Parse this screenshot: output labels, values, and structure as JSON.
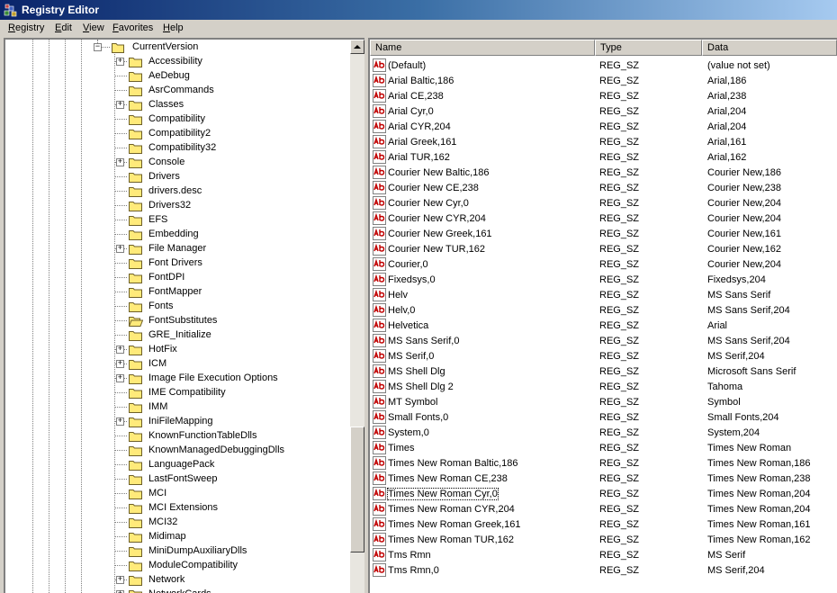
{
  "window": {
    "title": "Registry Editor"
  },
  "menu": [
    "Registry",
    "Edit",
    "View",
    "Favorites",
    "Help"
  ],
  "tree": {
    "parent": {
      "label": "CurrentVersion",
      "expanded": true
    },
    "items": [
      {
        "label": "Accessibility",
        "expandable": true
      },
      {
        "label": "AeDebug",
        "expandable": false
      },
      {
        "label": "AsrCommands",
        "expandable": false
      },
      {
        "label": "Classes",
        "expandable": true
      },
      {
        "label": "Compatibility",
        "expandable": false
      },
      {
        "label": "Compatibility2",
        "expandable": false
      },
      {
        "label": "Compatibility32",
        "expandable": false
      },
      {
        "label": "Console",
        "expandable": true
      },
      {
        "label": "Drivers",
        "expandable": false
      },
      {
        "label": "drivers.desc",
        "expandable": false
      },
      {
        "label": "Drivers32",
        "expandable": false
      },
      {
        "label": "EFS",
        "expandable": false
      },
      {
        "label": "Embedding",
        "expandable": false
      },
      {
        "label": "File Manager",
        "expandable": true
      },
      {
        "label": "Font Drivers",
        "expandable": false
      },
      {
        "label": "FontDPI",
        "expandable": false
      },
      {
        "label": "FontMapper",
        "expandable": false
      },
      {
        "label": "Fonts",
        "expandable": false
      },
      {
        "label": "FontSubstitutes",
        "expandable": false,
        "selected": true
      },
      {
        "label": "GRE_Initialize",
        "expandable": false
      },
      {
        "label": "HotFix",
        "expandable": true
      },
      {
        "label": "ICM",
        "expandable": true
      },
      {
        "label": "Image File Execution Options",
        "expandable": true
      },
      {
        "label": "IME Compatibility",
        "expandable": false
      },
      {
        "label": "IMM",
        "expandable": false
      },
      {
        "label": "IniFileMapping",
        "expandable": true
      },
      {
        "label": "KnownFunctionTableDlls",
        "expandable": false
      },
      {
        "label": "KnownManagedDebuggingDlls",
        "expandable": false
      },
      {
        "label": "LanguagePack",
        "expandable": false
      },
      {
        "label": "LastFontSweep",
        "expandable": false
      },
      {
        "label": "MCI",
        "expandable": false
      },
      {
        "label": "MCI Extensions",
        "expandable": false
      },
      {
        "label": "MCI32",
        "expandable": false
      },
      {
        "label": "Midimap",
        "expandable": false
      },
      {
        "label": "MiniDumpAuxiliaryDlls",
        "expandable": false
      },
      {
        "label": "ModuleCompatibility",
        "expandable": false
      },
      {
        "label": "Network",
        "expandable": true
      },
      {
        "label": "NetworkCards",
        "expandable": true
      }
    ]
  },
  "list": {
    "headers": {
      "name": "Name",
      "type": "Type",
      "data": "Data"
    },
    "rows": [
      {
        "name": "(Default)",
        "type": "REG_SZ",
        "data": "(value not set)"
      },
      {
        "name": "Arial Baltic,186",
        "type": "REG_SZ",
        "data": "Arial,186"
      },
      {
        "name": "Arial CE,238",
        "type": "REG_SZ",
        "data": "Arial,238"
      },
      {
        "name": "Arial Cyr,0",
        "type": "REG_SZ",
        "data": "Arial,204"
      },
      {
        "name": "Arial CYR,204",
        "type": "REG_SZ",
        "data": "Arial,204"
      },
      {
        "name": "Arial Greek,161",
        "type": "REG_SZ",
        "data": "Arial,161"
      },
      {
        "name": "Arial TUR,162",
        "type": "REG_SZ",
        "data": "Arial,162"
      },
      {
        "name": "Courier New Baltic,186",
        "type": "REG_SZ",
        "data": "Courier New,186"
      },
      {
        "name": "Courier New CE,238",
        "type": "REG_SZ",
        "data": "Courier New,238"
      },
      {
        "name": "Courier New Cyr,0",
        "type": "REG_SZ",
        "data": "Courier New,204"
      },
      {
        "name": "Courier New CYR,204",
        "type": "REG_SZ",
        "data": "Courier New,204"
      },
      {
        "name": "Courier New Greek,161",
        "type": "REG_SZ",
        "data": "Courier New,161"
      },
      {
        "name": "Courier New TUR,162",
        "type": "REG_SZ",
        "data": "Courier New,162"
      },
      {
        "name": "Courier,0",
        "type": "REG_SZ",
        "data": "Courier New,204"
      },
      {
        "name": "Fixedsys,0",
        "type": "REG_SZ",
        "data": "Fixedsys,204"
      },
      {
        "name": "Helv",
        "type": "REG_SZ",
        "data": "MS Sans Serif"
      },
      {
        "name": "Helv,0",
        "type": "REG_SZ",
        "data": "MS Sans Serif,204"
      },
      {
        "name": "Helvetica",
        "type": "REG_SZ",
        "data": "Arial"
      },
      {
        "name": "MS Sans Serif,0",
        "type": "REG_SZ",
        "data": "MS Sans Serif,204"
      },
      {
        "name": "MS Serif,0",
        "type": "REG_SZ",
        "data": "MS Serif,204"
      },
      {
        "name": "MS Shell Dlg",
        "type": "REG_SZ",
        "data": "Microsoft Sans Serif"
      },
      {
        "name": "MS Shell Dlg 2",
        "type": "REG_SZ",
        "data": "Tahoma"
      },
      {
        "name": "MT Symbol",
        "type": "REG_SZ",
        "data": "Symbol"
      },
      {
        "name": "Small Fonts,0",
        "type": "REG_SZ",
        "data": "Small Fonts,204"
      },
      {
        "name": "System,0",
        "type": "REG_SZ",
        "data": "System,204"
      },
      {
        "name": "Times",
        "type": "REG_SZ",
        "data": "Times New Roman"
      },
      {
        "name": "Times New Roman Baltic,186",
        "type": "REG_SZ",
        "data": "Times New Roman,186"
      },
      {
        "name": "Times New Roman CE,238",
        "type": "REG_SZ",
        "data": "Times New Roman,238"
      },
      {
        "name": "Times New Roman Cyr,0",
        "type": "REG_SZ",
        "data": "Times New Roman,204",
        "focused": true
      },
      {
        "name": "Times New Roman CYR,204",
        "type": "REG_SZ",
        "data": "Times New Roman,204"
      },
      {
        "name": "Times New Roman Greek,161",
        "type": "REG_SZ",
        "data": "Times New Roman,161"
      },
      {
        "name": "Times New Roman TUR,162",
        "type": "REG_SZ",
        "data": "Times New Roman,162"
      },
      {
        "name": "Tms Rmn",
        "type": "REG_SZ",
        "data": "MS Serif"
      },
      {
        "name": "Tms Rmn,0",
        "type": "REG_SZ",
        "data": "MS Serif,204"
      }
    ]
  },
  "icons": {
    "app": "registry-editor-icon",
    "folder": "folder-icon",
    "folder_open": "folder-open-icon",
    "string_value": "string-value-icon"
  },
  "colors": {
    "title_gradient_start": "#0a246a",
    "title_gradient_end": "#a6caf0",
    "window_face": "#d4d0c8",
    "folder_yellow": "#ffea7a",
    "value_icon_red": "#c00000"
  }
}
